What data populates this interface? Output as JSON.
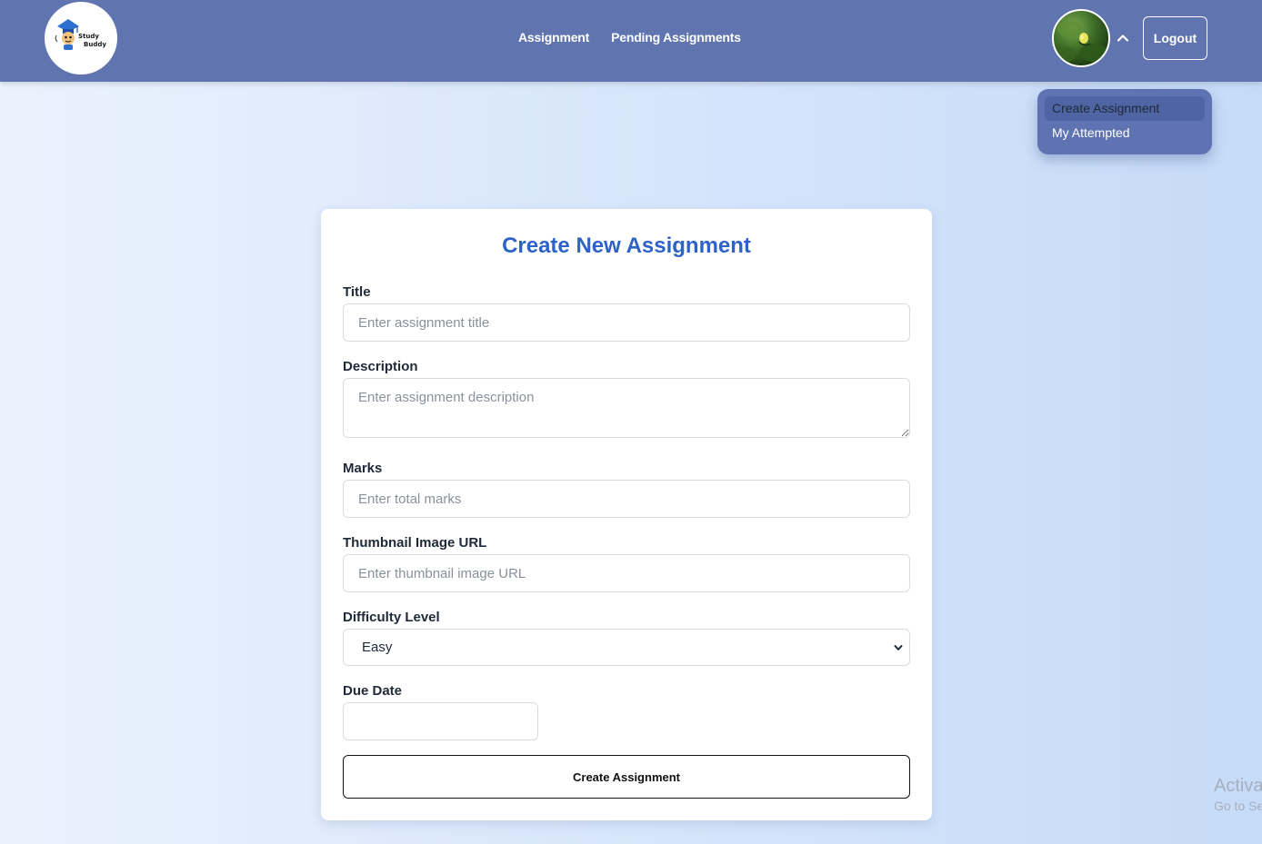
{
  "navbar": {
    "logo": {
      "line1": "Study",
      "line2": "Buddy"
    },
    "links": [
      "Assignment",
      "Pending Assignments"
    ],
    "logout_label": "Logout"
  },
  "dropdown": {
    "items": [
      "Create Assignment",
      "My Attempted"
    ]
  },
  "form": {
    "title": "Create New Assignment",
    "title_label": "Title",
    "title_placeholder": "Enter assignment title",
    "description_label": "Description",
    "description_placeholder": "Enter assignment description",
    "marks_label": "Marks",
    "marks_placeholder": "Enter total marks",
    "thumbnail_label": "Thumbnail Image URL",
    "thumbnail_placeholder": "Enter thumbnail image URL",
    "difficulty_label": "Difficulty Level",
    "difficulty_value": "Easy",
    "due_date_label": "Due Date",
    "submit_label": "Create Assignment"
  },
  "watermark": {
    "line1": "Activa",
    "line2": "Go to Se"
  },
  "colors": {
    "navbar": "#6075b0",
    "accent": "#2d63c8",
    "dropdown": "#5f73b2"
  }
}
